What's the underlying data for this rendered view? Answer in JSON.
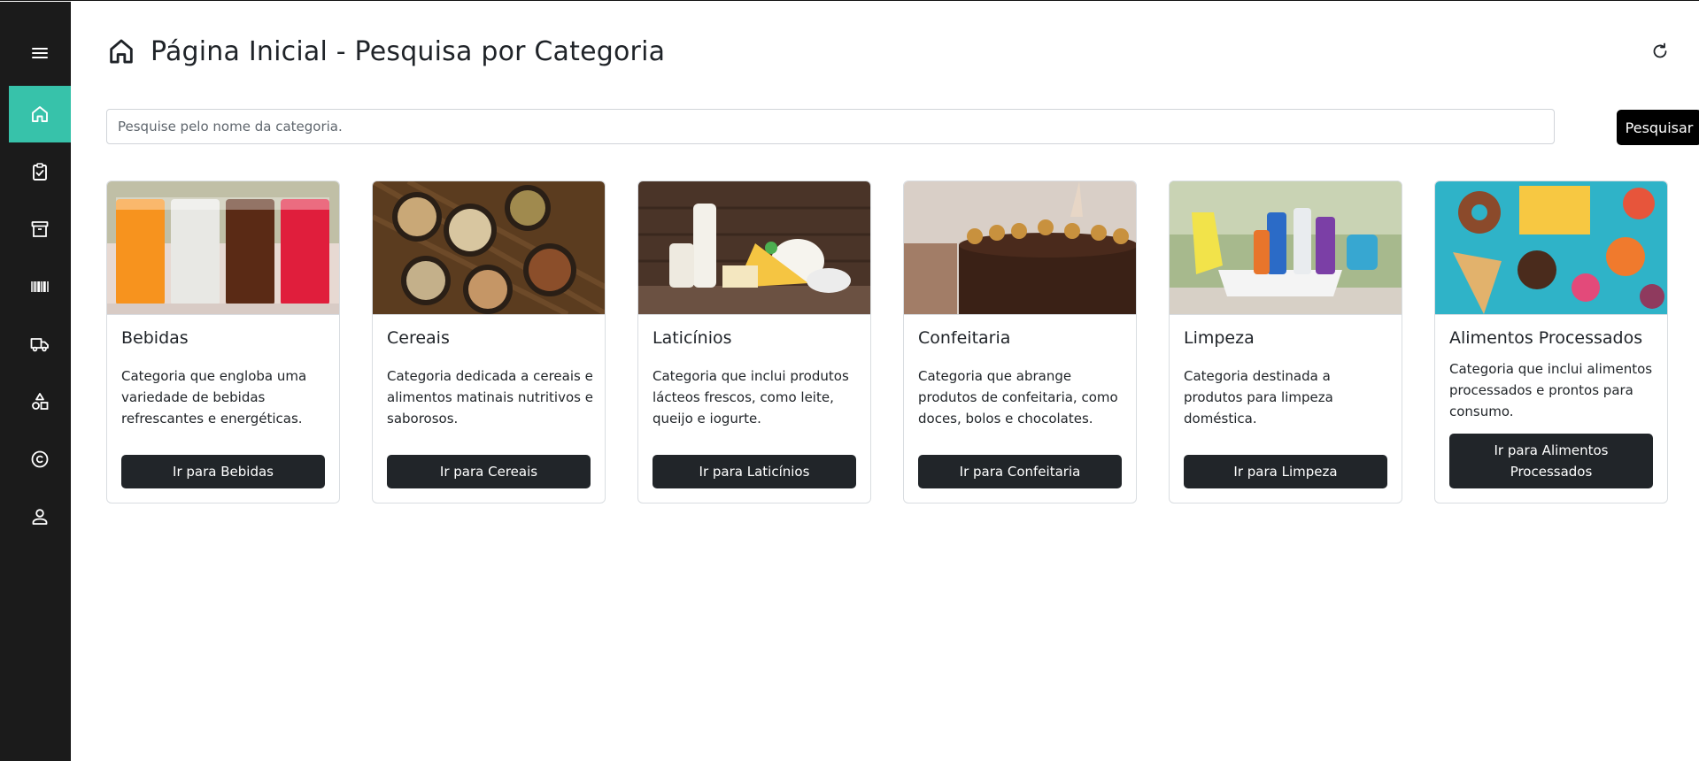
{
  "sidebar": {
    "items": [
      {
        "icon": "menu-icon"
      },
      {
        "icon": "home-icon",
        "active": true
      },
      {
        "icon": "clipboard-check-icon"
      },
      {
        "icon": "archive-icon"
      },
      {
        "icon": "barcode-icon"
      },
      {
        "icon": "truck-icon"
      },
      {
        "icon": "shapes-icon"
      },
      {
        "icon": "copyright-icon"
      },
      {
        "icon": "user-icon"
      }
    ],
    "accent": "#37c2aa"
  },
  "header": {
    "title": "Página Inicial - Pesquisa por Categoria",
    "icon": "home-icon",
    "refresh_icon": "refresh-icon"
  },
  "search": {
    "placeholder": "Pesquise pelo nome da categoria.",
    "value": "",
    "button_label": "Pesquisar"
  },
  "categories": [
    {
      "title": "Bebidas",
      "description": "Categoria que engloba uma variedade de bebidas refrescantes e energéticas.",
      "button": "Ir para Bebidas",
      "image": "drinks-photo"
    },
    {
      "title": "Cereais",
      "description": "Categoria dedicada a cereais e alimentos matinais nutritivos e saborosos.",
      "button": "Ir para Cereais",
      "image": "cereals-photo"
    },
    {
      "title": "Laticínios",
      "description": "Categoria que inclui produtos lácteos frescos, como leite, queijo e iogurte.",
      "button": "Ir para Laticínios",
      "image": "dairy-photo"
    },
    {
      "title": "Confeitaria",
      "description": "Categoria que abrange produtos de confeitaria, como doces, bolos e chocolates.",
      "button": "Ir para Confeitaria",
      "image": "cake-photo"
    },
    {
      "title": "Limpeza",
      "description": "Categoria destinada a produtos para limpeza doméstica.",
      "button": "Ir para Limpeza",
      "image": "cleaning-photo"
    },
    {
      "title": "Alimentos Processados",
      "description": "Categoria que inclui alimentos processados e prontos para consumo.",
      "button": "Ir para Alimentos Processados",
      "image": "processed-food-photo"
    }
  ]
}
